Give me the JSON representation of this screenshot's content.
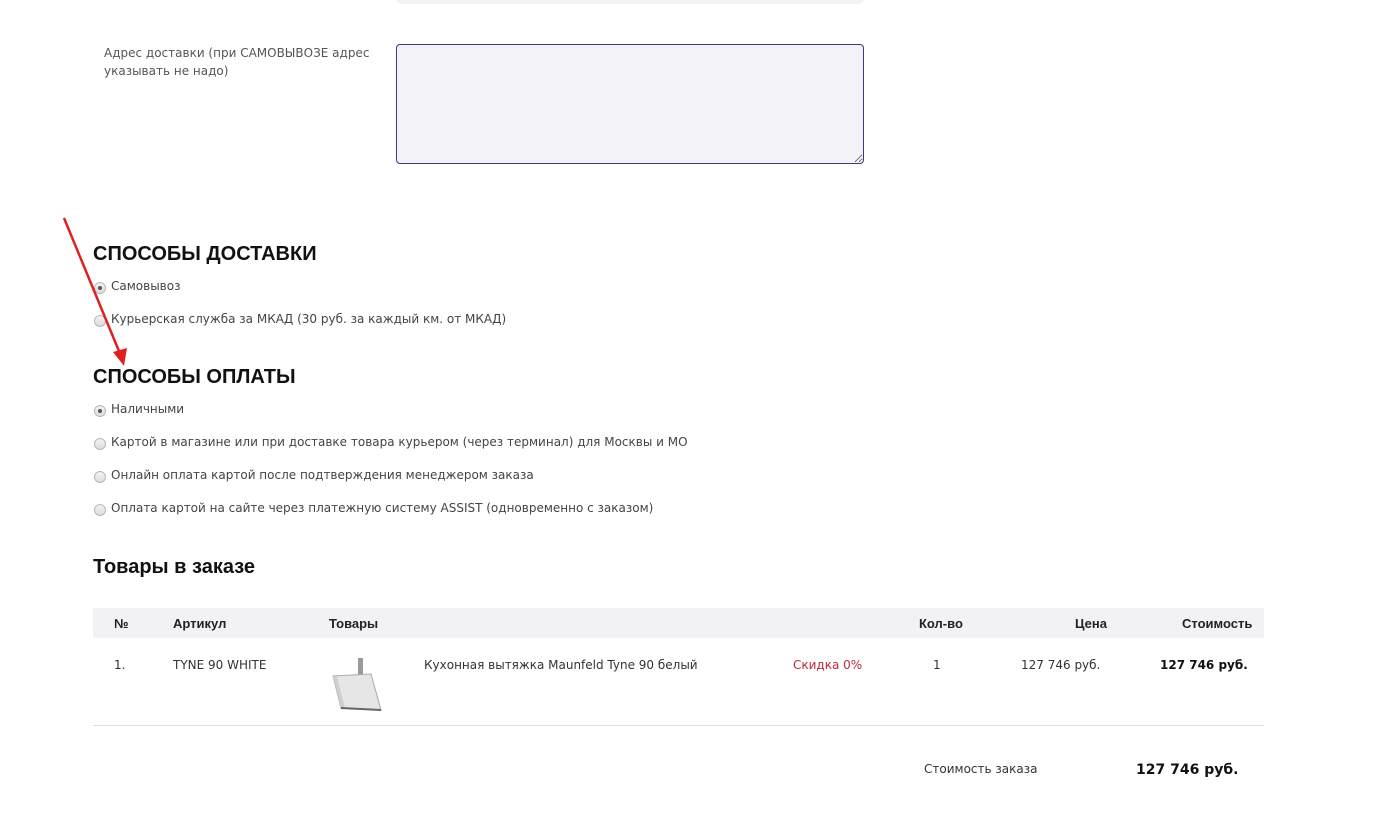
{
  "address": {
    "label": "Адрес доставки (при САМОВЫВОЗЕ адрес указывать не надо)",
    "value": ""
  },
  "delivery": {
    "title": "СПОСОБЫ ДОСТАВКИ",
    "options": [
      {
        "label": "Самовывоз",
        "checked": true
      },
      {
        "label": "Курьерская служба за МКАД (30 руб. за каждый км. от МКАД)",
        "checked": false
      }
    ]
  },
  "payment": {
    "title": "СПОСОБЫ ОПЛАТЫ",
    "options": [
      {
        "label": "Наличными",
        "checked": true
      },
      {
        "label": "Картой в магазине или при доставке товара курьером (через терминал) для Москвы и МО",
        "checked": false
      },
      {
        "label": "Онлайн оплата картой после подтверждения менеджером заказа",
        "checked": false
      },
      {
        "label": "Оплата картой на сайте через платежную систему ASSIST (одновременно с заказом)",
        "checked": false
      }
    ]
  },
  "goods": {
    "title": "Товары в заказе",
    "headers": {
      "num": "№",
      "article": "Артикул",
      "goods": "Товары",
      "qty": "Кол-во",
      "price": "Цена",
      "cost": "Стоимость"
    },
    "rows": [
      {
        "num": "1.",
        "article": "TYNE 90 WHITE",
        "image_icon": "range-hood-icon",
        "name": "Кухонная вытяжка Maunfeld Tyne 90 белый",
        "discount": "Скидка 0%",
        "qty": "1",
        "price": "127 746 руб.",
        "cost": "127 746 руб."
      }
    ]
  },
  "order_total": {
    "label": "Стоимость заказа",
    "value": "127 746 руб."
  },
  "colors": {
    "accent_arrow": "#e02020",
    "discount": "#c0283a",
    "input_border": "#3a3a7a"
  }
}
